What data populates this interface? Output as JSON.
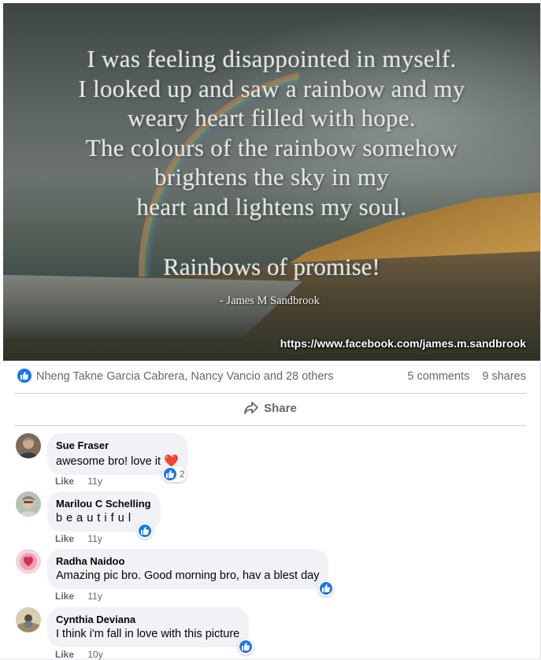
{
  "post": {
    "quote_lines": [
      "I was feeling disappointed in myself.",
      "I looked up and saw a rainbow and my",
      "weary heart filled with hope.",
      "The colours of the rainbow somehow",
      "brightens the sky in my",
      "heart and lightens my soul."
    ],
    "promise": "Rainbows of promise!",
    "author": "- James M Sandbrook",
    "url": "https://www.facebook.com/james.m.sandbrook"
  },
  "stats": {
    "reactors": "Nheng Takne Garcia Cabrera, Nancy Vancio and 28 others",
    "comments": "5 comments",
    "shares": "9 shares"
  },
  "actions": {
    "share_label": "Share"
  },
  "colors": {
    "accent": "#1877f2",
    "heart": "#e41e3f",
    "bubble": "#f0f2f5",
    "meta_text": "#65676b"
  },
  "comments": [
    {
      "author": "Sue Fraser",
      "text": "awesome bro! love it",
      "emoji": "❤️",
      "like": "Like",
      "time": "11y",
      "reaction_count": "2"
    },
    {
      "author": "Marilou C Schelling",
      "text": "b e a u t i f u l",
      "like": "Like",
      "time": "11y"
    },
    {
      "author": "Radha Naidoo",
      "text": "Amazing pic bro. Good morning bro, hav a blest day",
      "like": "Like",
      "time": "11y"
    },
    {
      "author": "Cynthia Deviana",
      "text": "I think i'm fall in love with this picture",
      "like": "Like",
      "time": "10y"
    }
  ]
}
